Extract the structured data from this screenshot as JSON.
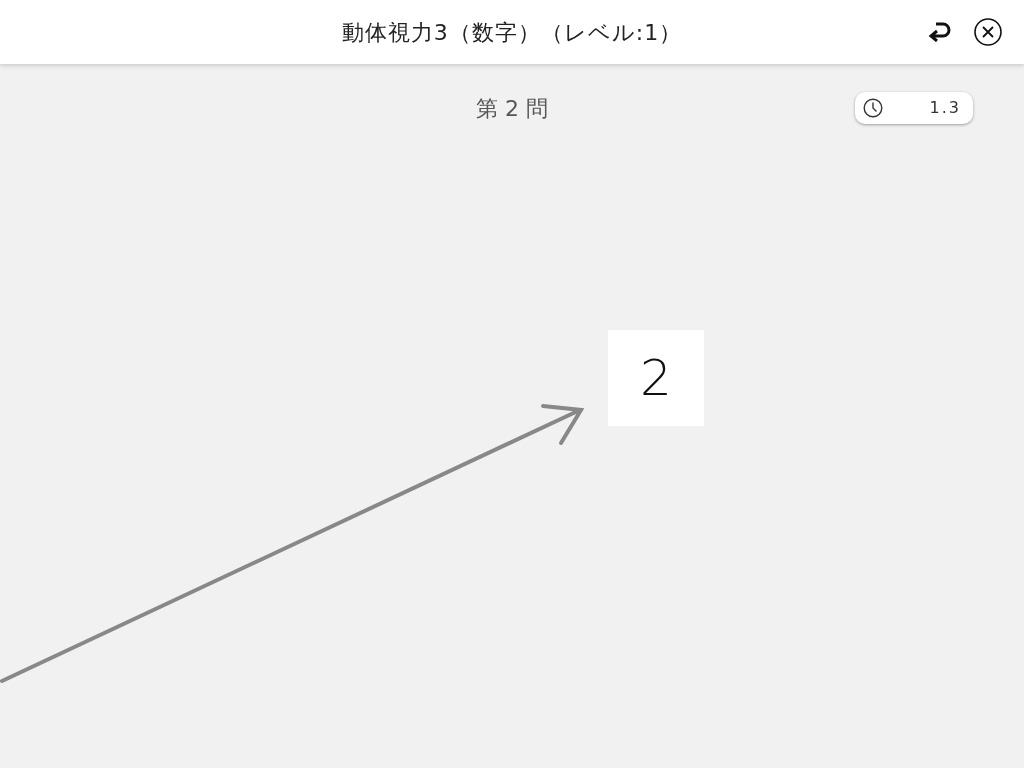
{
  "header": {
    "title": "動体視力3（数字）（レベル:1）"
  },
  "question_label": "第 2 問",
  "timer": {
    "reading": "1.3"
  },
  "stimulus": {
    "digit": "2"
  }
}
